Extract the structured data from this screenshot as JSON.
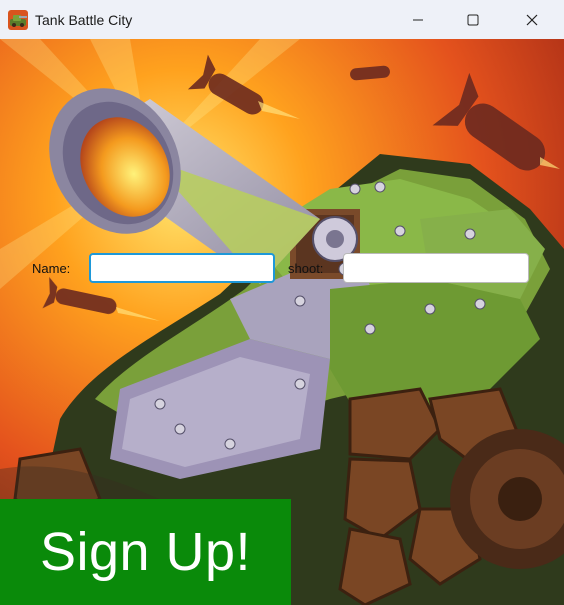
{
  "window": {
    "title": "Tank Battle City",
    "app_icon": "tank-app-icon",
    "controls": [
      "minimize-icon",
      "maximize-icon",
      "close-icon"
    ]
  },
  "form": {
    "name_label": "Name:",
    "name_value": "",
    "shoot_label": "shoot:",
    "shoot_value": "",
    "signup_label": "Sign Up!"
  },
  "colors": {
    "signup_bg": "#0a8a0a",
    "focus_border": "#1e98d8",
    "titlebar_bg": "#eef1f8"
  }
}
